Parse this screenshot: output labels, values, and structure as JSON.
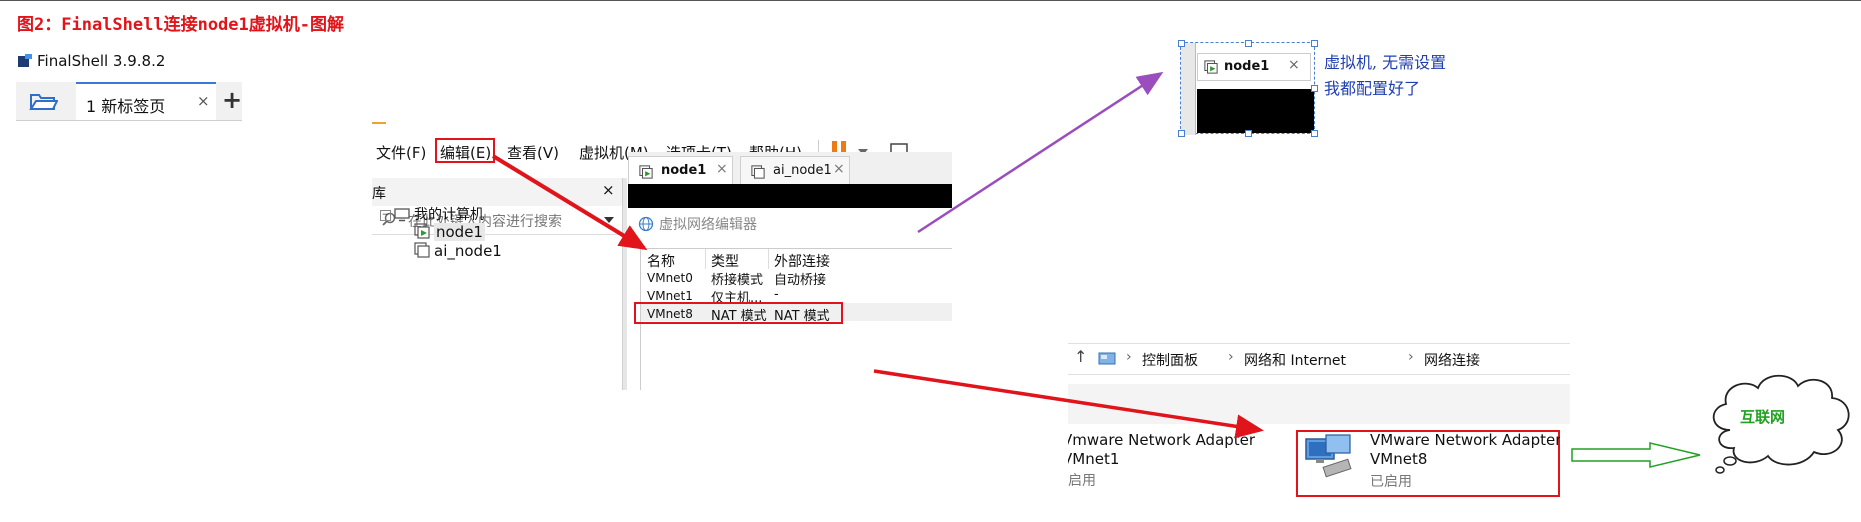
{
  "figure": {
    "title": "图2：FinalShell连接node1虚拟机-图解"
  },
  "finalshell": {
    "app_title": "FinalShell 3.9.8.2",
    "tab_label": "1 新标签页",
    "tab_close": "×",
    "add_tab": "+"
  },
  "vmware": {
    "menu": [
      "文件(F)",
      "编辑(E)",
      "查看(V)",
      "虚拟机(M)",
      "选项卡(T)",
      "帮助(H)"
    ],
    "library": {
      "title": "库",
      "close": "×",
      "search_placeholder": "在此处键入内容进行搜索"
    },
    "tree": {
      "root": "我的计算机",
      "items": [
        "node1",
        "ai_node1"
      ]
    },
    "tabs": [
      {
        "label": "node1",
        "close": "×"
      },
      {
        "label": "ai_node1",
        "close": "×"
      }
    ],
    "network_editor": {
      "title": "虚拟网络编辑器",
      "columns": [
        "名称",
        "类型",
        "外部连接"
      ],
      "rows": [
        [
          "VMnet0",
          "桥接模式",
          "自动桥接"
        ],
        [
          "VMnet1",
          "仅主机...",
          "-"
        ],
        [
          "VMnet8",
          "NAT 模式",
          "NAT 模式"
        ]
      ]
    }
  },
  "node1_snip": {
    "tab_label": "node1",
    "close": "×"
  },
  "annotation": {
    "line1": "虚拟机, 无需设置",
    "line2": "我都配置好了"
  },
  "network_connections": {
    "up": "↑",
    "breadcrumb": [
      "控制面板",
      "网络和 Internet",
      "网络连接"
    ],
    "adapter1": {
      "name": "Vmware Network Adapter",
      "net": "VMnet1",
      "status": "启用"
    },
    "adapter8": {
      "name": "VMware Network Adapter",
      "net": "VMnet8",
      "status": "已启用"
    }
  },
  "internet": {
    "label": "互联网"
  },
  "colors": {
    "red": "#e0141a",
    "purple": "#9b4dbd",
    "blue_text": "#1f3fb0",
    "green": "#22a122"
  }
}
